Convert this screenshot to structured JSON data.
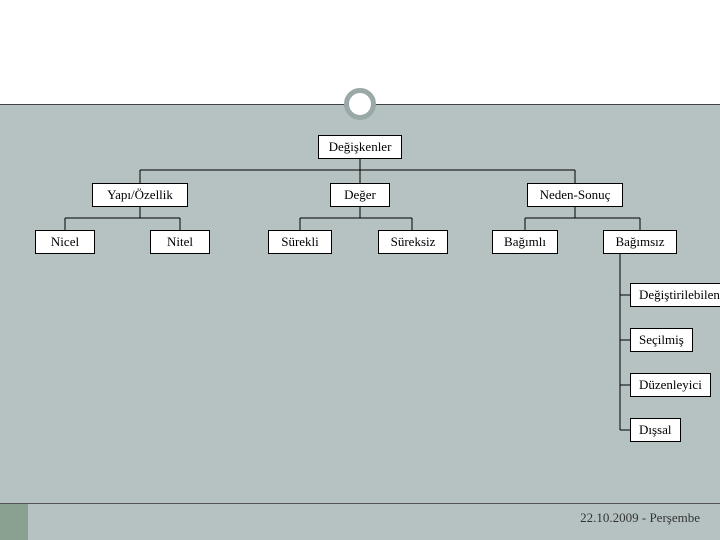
{
  "diagram": {
    "root": "Değişkenler",
    "level1": {
      "structure": "Yapı/Özellik",
      "value": "Değer",
      "cause": "Neden-Sonuç"
    },
    "level2": {
      "quantitative": "Nicel",
      "qualitative": "Nitel",
      "continuous": "Sürekli",
      "discrete": "Süreksiz",
      "dependent": "Bağımlı",
      "independent": "Bağımsız"
    },
    "level3": {
      "changeable": "Değiştirilebilen",
      "selected": "Seçilmiş",
      "moderator": "Düzenleyici",
      "external": "Dışsal"
    }
  },
  "footer": {
    "date": "22.10.2009 - Perşembe"
  }
}
